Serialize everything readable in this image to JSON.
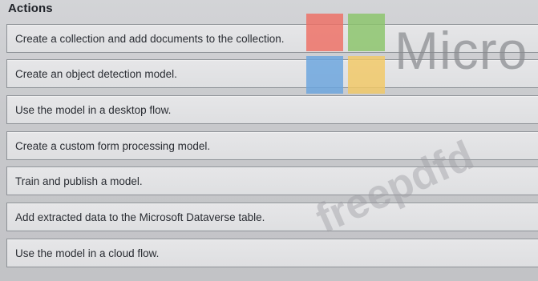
{
  "heading": "Actions",
  "actions": [
    {
      "label": "Create a collection and add documents to the collection."
    },
    {
      "label": "Create an object detection model."
    },
    {
      "label": "Use the model in a desktop flow."
    },
    {
      "label": "Create a custom form processing model."
    },
    {
      "label": "Train and publish a model."
    },
    {
      "label": "Add extracted data to the Microsoft Dataverse table."
    },
    {
      "label": "Use the model in a cloud flow."
    }
  ],
  "overlay": {
    "brand_text": "Micro",
    "watermark_text": "freepdfd"
  },
  "colors": {
    "logo_red": "#ef6f64",
    "logo_green": "#8bc56a",
    "logo_blue": "#6aa5df",
    "logo_yellow": "#f3c965"
  }
}
